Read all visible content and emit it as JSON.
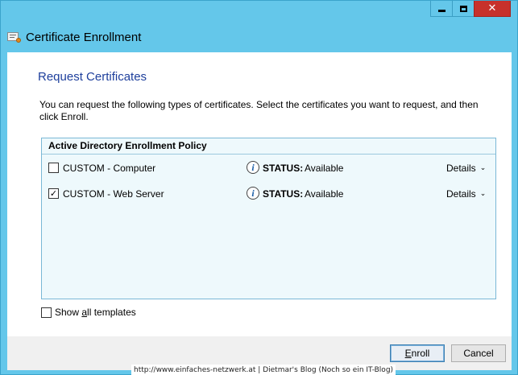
{
  "window": {
    "title": "Certificate Enrollment",
    "controls": {
      "minimize": "minimize",
      "maximize": "maximize",
      "close": "✕"
    }
  },
  "page": {
    "heading": "Request Certificates",
    "intro": "You can request the following types of certificates. Select the certificates you want to request, and then click Enroll."
  },
  "policy": {
    "header": "Active Directory Enrollment Policy",
    "status_label": "STATUS:",
    "items": [
      {
        "name": "CUSTOM - Computer",
        "checked": false,
        "status": "Available",
        "details": "Details"
      },
      {
        "name": "CUSTOM - Web Server",
        "checked": true,
        "status": "Available",
        "details": "Details"
      }
    ]
  },
  "show_all": {
    "label_pre": "Show ",
    "label_accel": "a",
    "label_post": "ll templates",
    "checked": false
  },
  "buttons": {
    "enroll": {
      "label_accel": "E",
      "label_rest": "nroll"
    },
    "cancel": "Cancel"
  },
  "watermark": "http://www.einfaches-netzwerk.at | Dietmar's Blog (Noch so ein IT-Blog)",
  "colors": {
    "titlebar": "#64c7ea",
    "close_button": "#c7312b",
    "heading": "#1e3f9c",
    "policy_bg": "#eef9fc"
  },
  "icons": {
    "app": "certificate-icon",
    "status": "info-icon",
    "details": "chevron-down-icon"
  }
}
